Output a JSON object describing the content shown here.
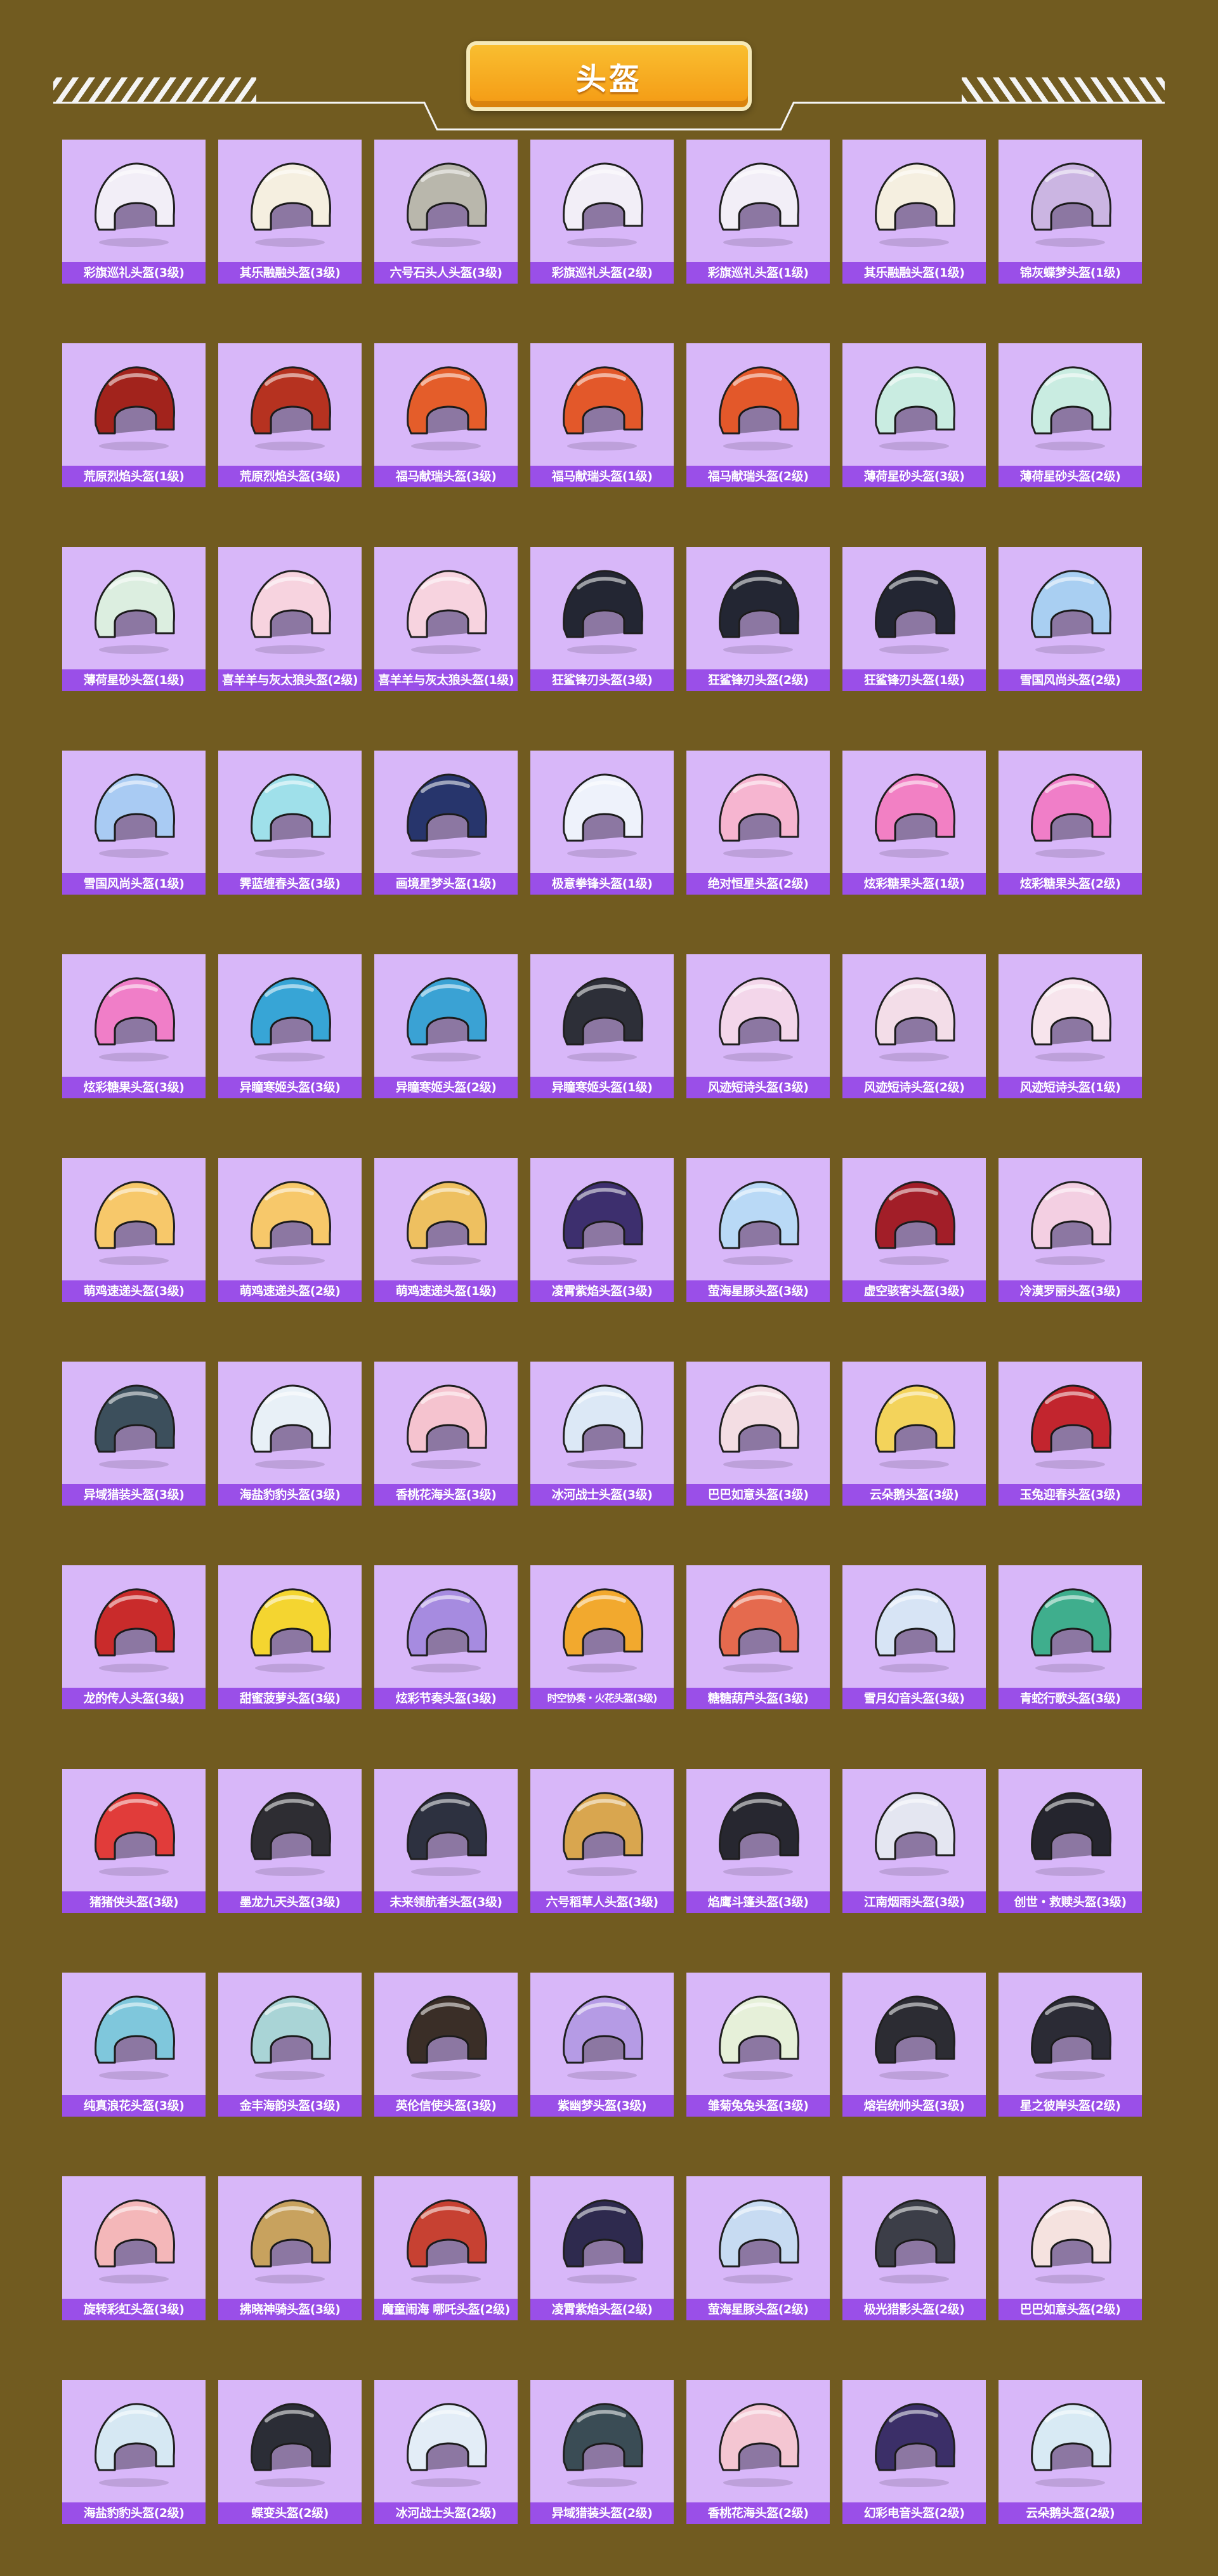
{
  "page": {
    "title": "头盔",
    "background": "#715b20",
    "accent": "#9a4fe8",
    "card_bg": "#d8b7f9"
  },
  "items": [
    {
      "name": "彩旗巡礼头盔(3级)",
      "color": "#f2eef7",
      "icon": "helmet-level3-icon"
    },
    {
      "name": "其乐融融头盔(3级)",
      "color": "#f5efe0",
      "icon": "helmet-level3-icon"
    },
    {
      "name": "六号石头人头盔(3级)",
      "color": "#b9b7ac",
      "icon": "helmet-level3-icon"
    },
    {
      "name": "彩旗巡礼头盔(2级)",
      "color": "#f2eef7",
      "icon": "helmet-level2-icon"
    },
    {
      "name": "彩旗巡礼头盔(1级)",
      "color": "#f2eef7",
      "icon": "helmet-level1-icon"
    },
    {
      "name": "其乐融融头盔(1级)",
      "color": "#f5efe0",
      "icon": "helmet-level1-icon"
    },
    {
      "name": "锦灰蝶梦头盔(1级)",
      "color": "#cbb5e2",
      "icon": "helmet-level1-icon"
    },
    {
      "name": "荒原烈焰头盔(1级)",
      "color": "#a2231c",
      "icon": "helmet-level1-icon"
    },
    {
      "name": "荒原烈焰头盔(3级)",
      "color": "#b63220",
      "icon": "helmet-level3-icon"
    },
    {
      "name": "福马献瑞头盔(3级)",
      "color": "#e45d2a",
      "icon": "helmet-level3-icon"
    },
    {
      "name": "福马献瑞头盔(1级)",
      "color": "#e3582a",
      "icon": "helmet-level1-icon"
    },
    {
      "name": "福马献瑞头盔(2级)",
      "color": "#e3582a",
      "icon": "helmet-level2-icon"
    },
    {
      "name": "薄荷星砂头盔(3级)",
      "color": "#c9ece1",
      "icon": "helmet-level3-icon"
    },
    {
      "name": "薄荷星砂头盔(2级)",
      "color": "#c9ece1",
      "icon": "helmet-level2-icon"
    },
    {
      "name": "薄荷星砂头盔(1级)",
      "color": "#dceee0",
      "icon": "helmet-level1-icon"
    },
    {
      "name": "喜羊羊与灰太狼头盔(2级)",
      "color": "#f7d3df",
      "icon": "helmet-level2-icon"
    },
    {
      "name": "喜羊羊与灰太狼头盔(1级)",
      "color": "#f7d3df",
      "icon": "helmet-level1-icon"
    },
    {
      "name": "狂鲨锋刃头盔(3级)",
      "color": "#232633",
      "icon": "helmet-level3-icon"
    },
    {
      "name": "狂鲨锋刃头盔(2级)",
      "color": "#232633",
      "icon": "helmet-level2-icon"
    },
    {
      "name": "狂鲨锋刃头盔(1级)",
      "color": "#232633",
      "icon": "helmet-level1-icon"
    },
    {
      "name": "雪国风尚头盔(2级)",
      "color": "#a9cff2",
      "icon": "helmet-level2-icon"
    },
    {
      "name": "雪国风尚头盔(1级)",
      "color": "#a9cbf3",
      "icon": "helmet-level1-icon"
    },
    {
      "name": "霁蓝缠春头盔(3级)",
      "color": "#9fe0ea",
      "icon": "helmet-level3-icon"
    },
    {
      "name": "画境星梦头盔(1级)",
      "color": "#27356c",
      "icon": "helmet-level1-icon"
    },
    {
      "name": "极意拳锋头盔(1级)",
      "color": "#eef2fb",
      "icon": "helmet-level1-icon"
    },
    {
      "name": "绝对恒星头盔(2级)",
      "color": "#f6b5d0",
      "icon": "helmet-level2-icon"
    },
    {
      "name": "炫彩糖果头盔(1级)",
      "color": "#f280c4",
      "icon": "helmet-level1-icon"
    },
    {
      "name": "炫彩糖果头盔(2级)",
      "color": "#f07ec8",
      "icon": "helmet-level2-icon"
    },
    {
      "name": "炫彩糖果头盔(3级)",
      "color": "#f07ec8",
      "icon": "helmet-level3-icon"
    },
    {
      "name": "异瞳寒姬头盔(3级)",
      "color": "#37a5d6",
      "icon": "helmet-level3-icon"
    },
    {
      "name": "异瞳寒姬头盔(2级)",
      "color": "#3aa2d4",
      "icon": "helmet-level2-icon"
    },
    {
      "name": "异瞳寒姬头盔(1级)",
      "color": "#2d2f38",
      "icon": "helmet-level1-icon"
    },
    {
      "name": "风迹短诗头盔(3级)",
      "color": "#f3d6ea",
      "icon": "helmet-level3-icon"
    },
    {
      "name": "风迹短诗头盔(2级)",
      "color": "#f3dde8",
      "icon": "helmet-level2-icon"
    },
    {
      "name": "风迹短诗头盔(1级)",
      "color": "#f7e4ec",
      "icon": "helmet-level1-icon"
    },
    {
      "name": "萌鸡速递头盔(3级)",
      "color": "#f7c86a",
      "icon": "helmet-level3-icon"
    },
    {
      "name": "萌鸡速递头盔(2级)",
      "color": "#f7c86a",
      "icon": "helmet-level2-icon"
    },
    {
      "name": "萌鸡速递头盔(1级)",
      "color": "#eec060",
      "icon": "helmet-level1-icon"
    },
    {
      "name": "凌霄紫焰头盔(3级)",
      "color": "#3d2f6e",
      "icon": "helmet-level3-icon"
    },
    {
      "name": "萤海星豚头盔(3级)",
      "color": "#b9d9f6",
      "icon": "helmet-level3-icon"
    },
    {
      "name": "虚空骇客头盔(3级)",
      "color": "#a21e28",
      "icon": "helmet-level3-icon"
    },
    {
      "name": "冷漠罗丽头盔(3级)",
      "color": "#f3cfe2",
      "icon": "helmet-level3-icon"
    },
    {
      "name": "异域猎装头盔(3级)",
      "color": "#3c4f5c",
      "icon": "helmet-level3-icon"
    },
    {
      "name": "海盐豹豹头盔(3级)",
      "color": "#e8f0f7",
      "icon": "helmet-level3-icon"
    },
    {
      "name": "香桃花海头盔(3级)",
      "color": "#f5c3cf",
      "icon": "helmet-level3-icon"
    },
    {
      "name": "冰河战士头盔(3级)",
      "color": "#dce8f6",
      "icon": "helmet-level3-icon"
    },
    {
      "name": "巴巴如意头盔(3级)",
      "color": "#f3dde3",
      "icon": "helmet-level3-icon"
    },
    {
      "name": "云朵鹅头盔(3级)",
      "color": "#f3d35b",
      "icon": "helmet-level3-icon"
    },
    {
      "name": "玉兔迎春头盔(3级)",
      "color": "#c2252e",
      "icon": "helmet-level3-icon"
    },
    {
      "name": "龙的传人头盔(3级)",
      "color": "#c92b2b",
      "icon": "helmet-level3-icon"
    },
    {
      "name": "甜蜜菠萝头盔(3级)",
      "color": "#f4d530",
      "icon": "helmet-level3-icon"
    },
    {
      "name": "炫彩节奏头盔(3级)",
      "color": "#a68be0",
      "icon": "helmet-level3-icon"
    },
    {
      "name": "时空协奏・火花头盔(3级)",
      "color": "#f2a92e",
      "icon": "helmet-level3-icon",
      "small": true
    },
    {
      "name": "糖糖葫芦头盔(3级)",
      "color": "#e56a4e",
      "icon": "helmet-level3-icon"
    },
    {
      "name": "雪月幻音头盔(3级)",
      "color": "#d7e4f5",
      "icon": "helmet-level3-icon"
    },
    {
      "name": "青蛇行歌头盔(3级)",
      "color": "#3fae8d",
      "icon": "helmet-level3-icon"
    },
    {
      "name": "猪猪侠头盔(3级)",
      "color": "#e13c3a",
      "icon": "helmet-level3-icon"
    },
    {
      "name": "墨龙九天头盔(3级)",
      "color": "#2e2d33",
      "icon": "helmet-level3-icon"
    },
    {
      "name": "未来领航者头盔(3级)",
      "color": "#2d3140",
      "icon": "helmet-level3-icon"
    },
    {
      "name": "六号稻草人头盔(3级)",
      "color": "#d9a64f",
      "icon": "helmet-level3-icon"
    },
    {
      "name": "焰鹰斗篷头盔(3级)",
      "color": "#272730",
      "icon": "helmet-level3-icon"
    },
    {
      "name": "江南烟雨头盔(3级)",
      "color": "#e4e6f1",
      "icon": "helmet-level3-icon"
    },
    {
      "name": "创世・救赎头盔(3级)",
      "color": "#25252e",
      "icon": "helmet-level3-icon"
    },
    {
      "name": "纯真浪花头盔(3级)",
      "color": "#7fc7dc",
      "icon": "helmet-level3-icon"
    },
    {
      "name": "金丰海韵头盔(3级)",
      "color": "#a9d4d6",
      "icon": "helmet-level3-icon"
    },
    {
      "name": "英伦信使头盔(3级)",
      "color": "#3a2e27",
      "icon": "helmet-level3-icon"
    },
    {
      "name": "紫幽梦头盔(3级)",
      "color": "#b59be5",
      "icon": "helmet-level3-icon"
    },
    {
      "name": "雏菊兔兔头盔(3级)",
      "color": "#e6f0d9",
      "icon": "helmet-level3-icon"
    },
    {
      "name": "熔岩统帅头盔(3级)",
      "color": "#2c2c33",
      "icon": "helmet-level3-icon"
    },
    {
      "name": "星之彼岸头盔(2级)",
      "color": "#2b2b35",
      "icon": "helmet-level2-icon"
    },
    {
      "name": "旋转彩虹头盔(3级)",
      "color": "#f4b7b9",
      "icon": "helmet-level3-icon"
    },
    {
      "name": "拂晓神骑头盔(3级)",
      "color": "#c8a25e",
      "icon": "helmet-level3-icon"
    },
    {
      "name": "魔童闹海 哪吒头盔(2级)",
      "color": "#c74132",
      "icon": "helmet-level2-icon"
    },
    {
      "name": "凌霄紫焰头盔(2级)",
      "color": "#2e2a4e",
      "icon": "helmet-level2-icon"
    },
    {
      "name": "萤海星豚头盔(2级)",
      "color": "#c7dbf2",
      "icon": "helmet-level2-icon"
    },
    {
      "name": "极光猎影头盔(2级)",
      "color": "#3c3e48",
      "icon": "helmet-level2-icon"
    },
    {
      "name": "巴巴如意头盔(2级)",
      "color": "#f5e2df",
      "icon": "helmet-level2-icon"
    },
    {
      "name": "海盐豹豹头盔(2级)",
      "color": "#d6e8f3",
      "icon": "helmet-level2-icon"
    },
    {
      "name": "蝶变头盔(2级)",
      "color": "#2b2d36",
      "icon": "helmet-level2-icon"
    },
    {
      "name": "冰河战士头盔(2级)",
      "color": "#e3edf7",
      "icon": "helmet-level2-icon"
    },
    {
      "name": "异域猎装头盔(2级)",
      "color": "#3a4c55",
      "icon": "helmet-level2-icon"
    },
    {
      "name": "香桃花海头盔(2级)",
      "color": "#f4c6d2",
      "icon": "helmet-level2-icon"
    },
    {
      "name": "幻彩电音头盔(2级)",
      "color": "#3b2f68",
      "icon": "helmet-level2-icon"
    },
    {
      "name": "云朵鹅头盔(2级)",
      "color": "#d8eaf4",
      "icon": "helmet-level2-icon"
    }
  ]
}
